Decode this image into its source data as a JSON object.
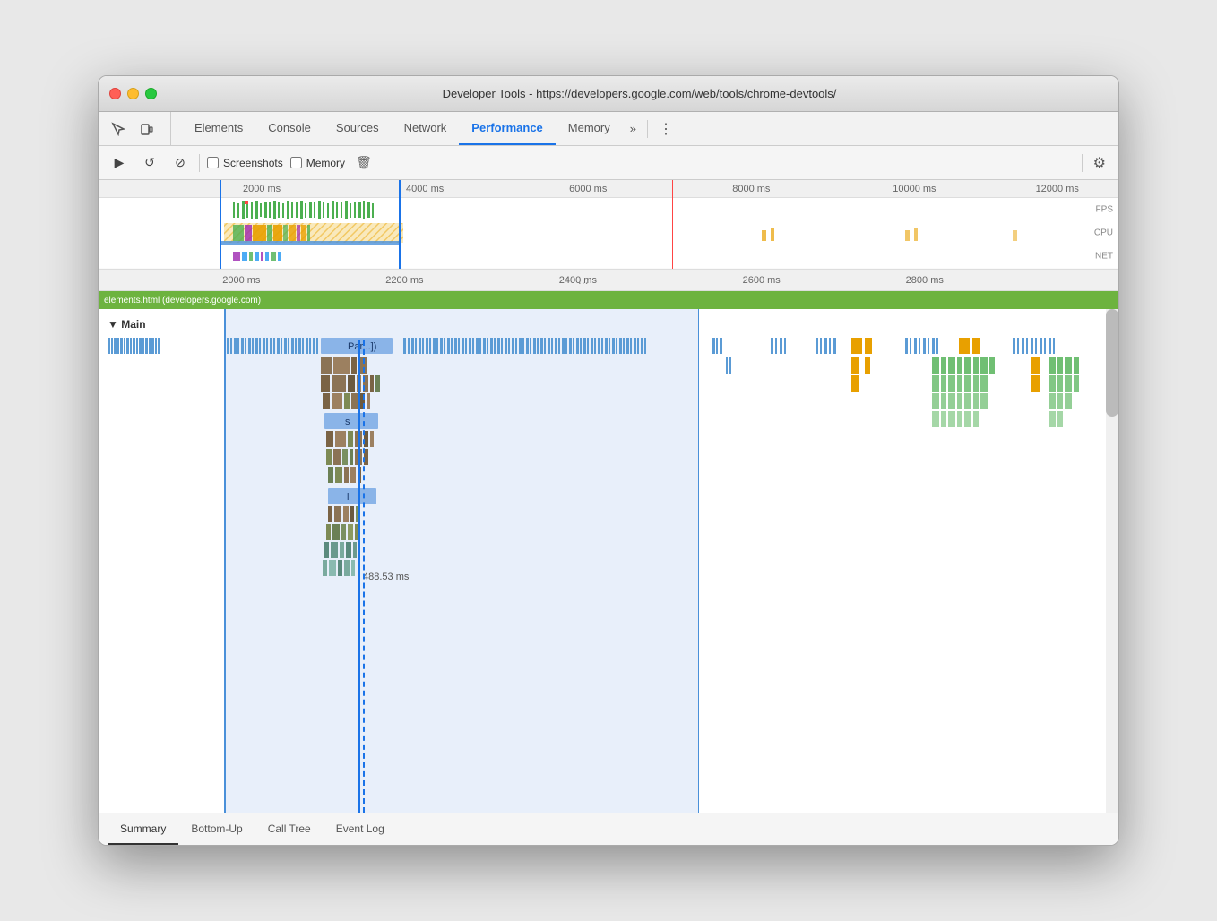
{
  "window": {
    "title": "Developer Tools - https://developers.google.com/web/tools/chrome-devtools/"
  },
  "tabs": {
    "items": [
      {
        "label": "Elements",
        "active": false
      },
      {
        "label": "Console",
        "active": false
      },
      {
        "label": "Sources",
        "active": false
      },
      {
        "label": "Network",
        "active": false
      },
      {
        "label": "Performance",
        "active": true
      },
      {
        "label": "Memory",
        "active": false
      }
    ],
    "more_label": "»",
    "menu_label": "⋮"
  },
  "toolbar": {
    "record_label": "▶",
    "reload_label": "↺",
    "clear_label": "⊘",
    "screenshots_label": "Screenshots",
    "memory_label": "Memory",
    "trash_label": "🗑",
    "gear_label": "⚙"
  },
  "ruler": {
    "marks_overview": [
      "2000 ms",
      "4000 ms",
      "6000 ms",
      "8000 ms",
      "10000 ms",
      "12000 ms"
    ],
    "marks_flame": [
      "2000 ms",
      "2200 ms",
      "2400 ms",
      "2600 ms",
      "2800 ms"
    ],
    "fps_label": "FPS",
    "cpu_label": "CPU",
    "net_label": "NET"
  },
  "flame": {
    "main_label": "▼ Main",
    "par_label": "Par...])",
    "s_label": "s",
    "l_label": "l",
    "time_label": "488.53 ms",
    "url_bar": "elements.html (developers.google.com)"
  },
  "bottom_tabs": {
    "items": [
      {
        "label": "Summary",
        "active": true
      },
      {
        "label": "Bottom-Up",
        "active": false
      },
      {
        "label": "Call Tree",
        "active": false
      },
      {
        "label": "Event Log",
        "active": false
      }
    ]
  }
}
